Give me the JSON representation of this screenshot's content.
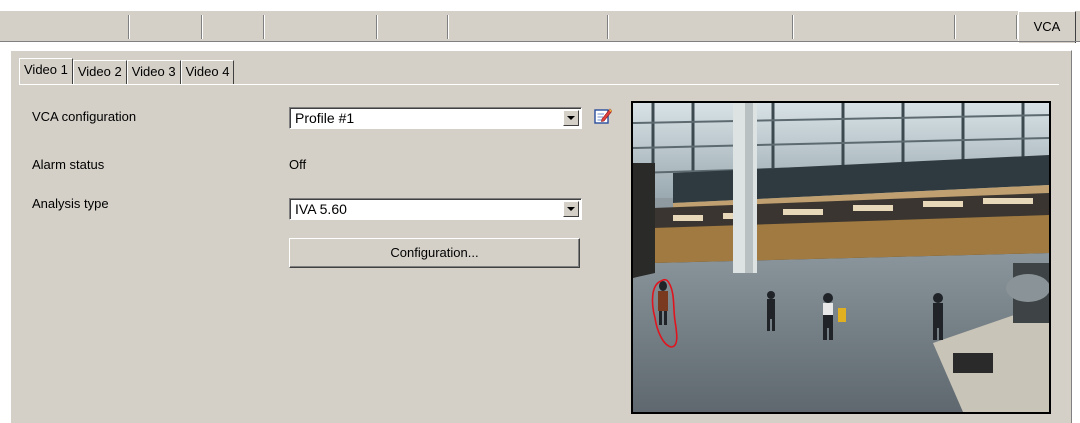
{
  "top_tabs": {
    "active_label": "VCA",
    "separators": [
      130,
      203,
      265,
      378,
      449,
      609,
      794,
      956,
      1018
    ]
  },
  "video_tabs": [
    {
      "label": "Video 1",
      "active": true
    },
    {
      "label": "Video 2",
      "active": false
    },
    {
      "label": "Video 3",
      "active": false
    },
    {
      "label": "Video 4",
      "active": false
    }
  ],
  "form": {
    "vca_configuration_label": "VCA configuration",
    "vca_configuration_value": "Profile #1",
    "alarm_status_label": "Alarm status",
    "alarm_status_value": "Off",
    "analysis_type_label": "Analysis type",
    "analysis_type_value": "IVA 5.60",
    "configuration_button": "Configuration..."
  },
  "icons": {
    "edit": "edit-config-icon",
    "dropdown": "chevron-down-icon"
  },
  "colors": {
    "panel": "#d4d0c8",
    "detection_outline": "#e0141e"
  }
}
